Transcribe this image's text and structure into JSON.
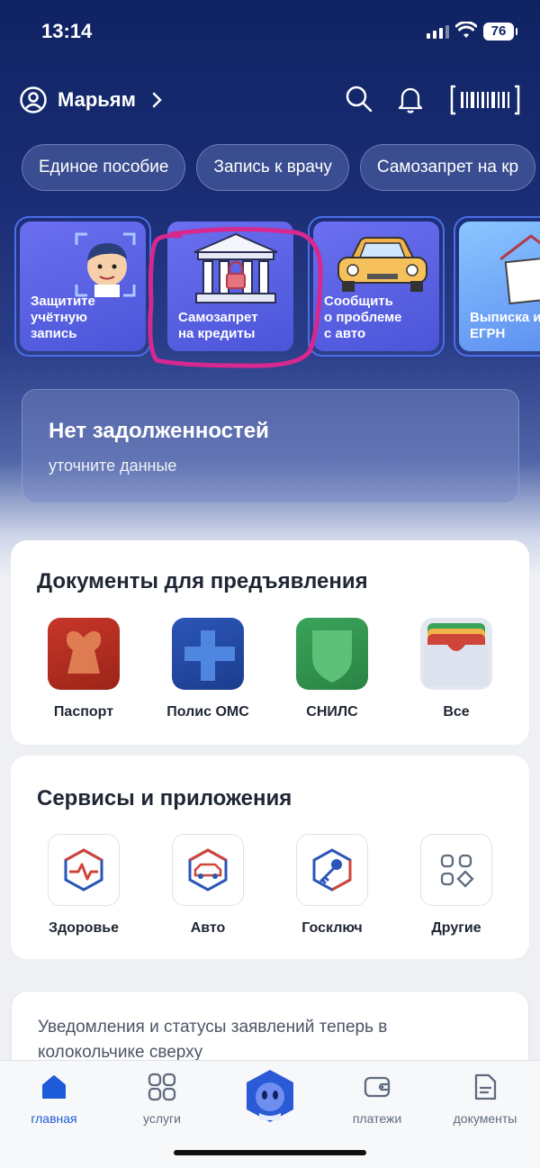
{
  "status_bar": {
    "time": "13:14",
    "battery": "76"
  },
  "header": {
    "profile_name": "Марьям"
  },
  "chips": [
    "Единое пособие",
    "Запись к врачу",
    "Самозапрет на кр"
  ],
  "stories": [
    {
      "label": "Защитите\nучётную\nзапись",
      "icon": "face-scan-illustration"
    },
    {
      "label": "Самозапрет\nна кредиты",
      "icon": "bank-lock-illustration"
    },
    {
      "label": "Сообщить\nо проблеме\nс авто",
      "icon": "car-illustration"
    },
    {
      "label": "Выписка и\nЕГРН",
      "icon": "house-document-illustration"
    }
  ],
  "debt": {
    "title": "Нет задолженностей",
    "subtitle": "уточните данные"
  },
  "documents": {
    "title": "Документы для предъявления",
    "items": [
      {
        "label": "Паспорт",
        "icon": "passport-icon"
      },
      {
        "label": "Полис ОМС",
        "icon": "oms-policy-icon"
      },
      {
        "label": "СНИЛС",
        "icon": "snils-icon"
      },
      {
        "label": "Все",
        "icon": "wallet-icon"
      }
    ]
  },
  "services": {
    "title": "Сервисы и приложения",
    "items": [
      {
        "label": "Здоровье",
        "icon": "health-icon"
      },
      {
        "label": "Авто",
        "icon": "car-icon"
      },
      {
        "label": "Госключ",
        "icon": "key-icon"
      },
      {
        "label": "Другие",
        "icon": "apps-grid-icon"
      }
    ]
  },
  "notice": {
    "text": "Уведомления и статусы заявлений теперь в колокольчике сверху"
  },
  "tabbar": {
    "items": [
      {
        "label": "главная",
        "icon": "home-icon"
      },
      {
        "label": "услуги",
        "icon": "grid-icon"
      },
      {
        "label": "платежи",
        "icon": "wallet-icon"
      },
      {
        "label": "документы",
        "icon": "document-icon"
      }
    ],
    "active_color": "#1d5bd8"
  },
  "colors": {
    "hero_top": "#0f2363",
    "accent": "#1d5bd8",
    "annotation_circle": "#d6288f"
  }
}
